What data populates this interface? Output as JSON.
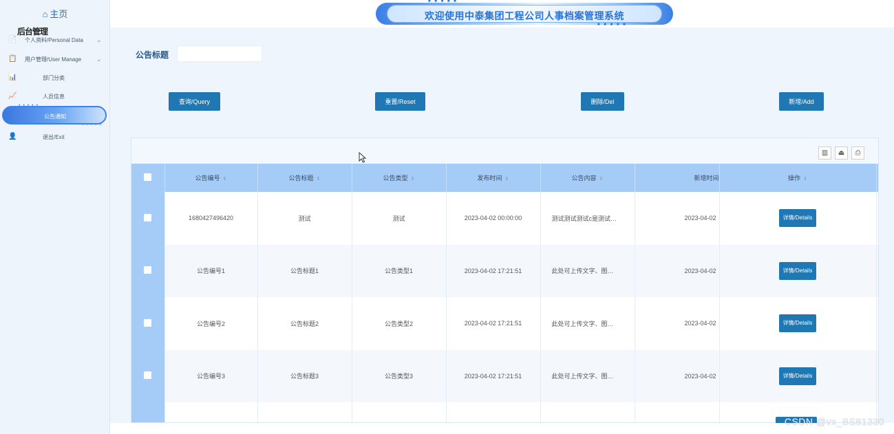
{
  "sidebar": {
    "home_glyph": "⌂",
    "home_label": "主页",
    "overlay_text": "后台管理",
    "items": [
      {
        "icon": "📄",
        "label": "个人资料/Personal Data",
        "chevron": "⌄"
      },
      {
        "icon": "📋",
        "label": "用户管理/User Manage",
        "chevron": "⌄"
      },
      {
        "icon": "📊",
        "label": "部门分类"
      },
      {
        "icon": "📈",
        "label": "人员信息"
      },
      {
        "icon": "",
        "label": "公告通知"
      },
      {
        "icon": "👤",
        "label": "退出/Exit"
      }
    ],
    "dots": "• • • • •"
  },
  "header": {
    "title": "欢迎使用中泰集团工程公司人事档案管理系统",
    "dots": "■ ■ ■ ■ ■"
  },
  "search": {
    "label": "公告标题",
    "value": ""
  },
  "buttons": {
    "query": "查询/Query",
    "reset": "重置/Reset",
    "delete": "删除/Del",
    "add": "新增/Add"
  },
  "toolbar_icons": {
    "columns": "▥",
    "export": "⏏",
    "print": "⎙"
  },
  "table": {
    "sort_glyph": "⇕",
    "headers": {
      "code": "公告编号",
      "title": "公告标题",
      "type": "公告类型",
      "time": "发布时间",
      "content": "公告内容",
      "added": "新增时间",
      "op": "操作"
    },
    "rows": [
      {
        "code": "1680427496420",
        "title": "测试",
        "type": "测试",
        "time": "2023-04-02 00:00:00",
        "content": "测试测试测试c是测试…",
        "added": "2023-04-02",
        "detail": "详情/Details",
        "tail": "l"
      },
      {
        "code": "公告编号1",
        "title": "公告标题1",
        "type": "公告类型1",
        "time": "2023-04-02 17:21:51",
        "content": "此处可上传文字、图…",
        "added": "2023-04-02",
        "detail": "详情/Details",
        "tail": "l"
      },
      {
        "code": "公告编号2",
        "title": "公告标题2",
        "type": "公告类型2",
        "time": "2023-04-02 17:21:51",
        "content": "此处可上传文字、图…",
        "added": "2023-04-02",
        "detail": "详情/Details",
        "tail": "l"
      },
      {
        "code": "公告编号3",
        "title": "公告标题3",
        "type": "公告类型3",
        "time": "2023-04-02 17:21:51",
        "content": "此处可上传文字、图…",
        "added": "2023-04-02",
        "detail": "详情/Details",
        "tail": "l"
      },
      {
        "code": "",
        "title": "",
        "type": "",
        "time": "",
        "content": "",
        "added": "",
        "detail": "",
        "tail": ""
      }
    ]
  },
  "watermark": "CSDN @vx_BS81330",
  "colors": {
    "primary": "#1f77b4",
    "header_row": "#a5cbf7",
    "sidebar_bg": "#edf4fb",
    "active_pill": "#3d82e8"
  }
}
